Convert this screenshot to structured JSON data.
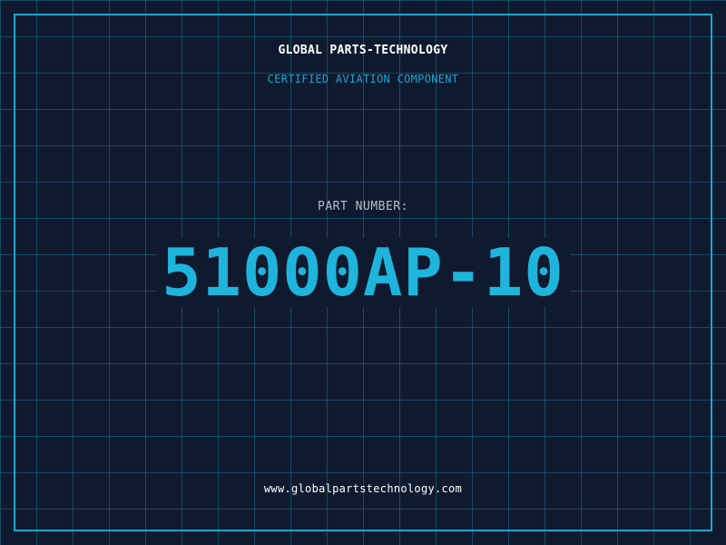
{
  "header": {
    "company": "GLOBAL PARTS-TECHNOLOGY",
    "tagline": "CERTIFIED AVIATION COMPONENT"
  },
  "part": {
    "label": "PART NUMBER:",
    "number": "51000AP-10"
  },
  "footer": {
    "url": "www.globalpartstechnology.com"
  },
  "colors": {
    "background": "#101a2f",
    "accent": "#1aa6d0",
    "part_number": "#1eb4dc",
    "label": "#b4bfcb",
    "text": "#ffffff"
  }
}
